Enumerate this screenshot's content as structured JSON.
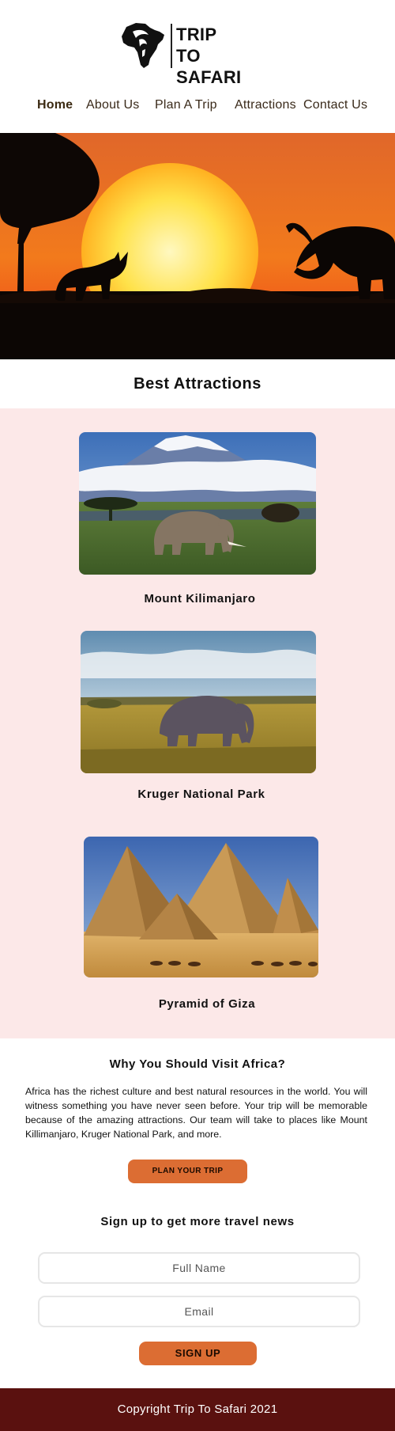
{
  "brand": {
    "line1": "TRIP TO",
    "line2": "SAFARI"
  },
  "nav": {
    "items": [
      {
        "label": "Home",
        "active": true
      },
      {
        "label": "About Us",
        "active": false
      },
      {
        "label": "Plan A Trip",
        "active": false
      },
      {
        "label": "Attractions",
        "active": false
      },
      {
        "label": "Contact Us",
        "active": false
      }
    ]
  },
  "attractions": {
    "title": "Best Attractions",
    "cards": [
      {
        "caption": "Mount Kilimanjaro"
      },
      {
        "caption": "Kruger National Park"
      },
      {
        "caption": "Pyramid of Giza"
      }
    ]
  },
  "why": {
    "title": "Why You Should Visit Africa?",
    "text": "Africa has the richest culture and best natural resources in the world. You will witness something you have never seen before. Your trip will be memorable because of the amazing attractions. Our team will take to places like Mount Killimanjaro, Kruger National Park, and more.",
    "button": "PLAN YOUR TRIP"
  },
  "signup": {
    "title": "Sign up to get more travel news",
    "name_placeholder": "Full Name",
    "email_placeholder": "Email",
    "button": "SIGN UP"
  },
  "footer": {
    "text": "Copyright Trip To Safari 2021"
  },
  "colors": {
    "accent": "#dc6d33",
    "section_bg": "#fce8e8",
    "footer_bg": "#5a110f"
  },
  "icons": {
    "logo": "africa-continent-silhouette-icon"
  }
}
